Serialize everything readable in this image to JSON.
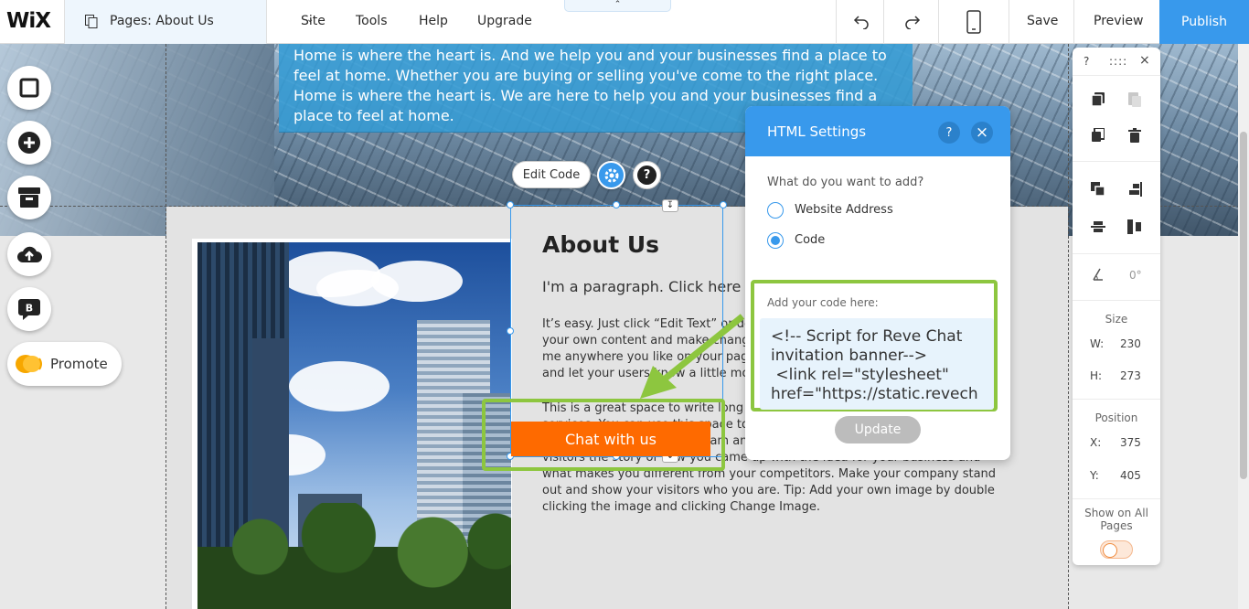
{
  "topbar": {
    "logo": "WiX",
    "pages_label": "Pages: About Us",
    "menu": [
      "Site",
      "Tools",
      "Help",
      "Upgrade"
    ],
    "handle_glyph": "⌃",
    "save": "Save",
    "preview": "Preview",
    "publish": "Publish"
  },
  "hero": {
    "text": "Home is where the heart is. And we help you and your businesses find a place to feel at home. Whether you are buying or selling you've come to the right place. Home is where the heart is. We  are here to help you and your businesses find a place to feel at home."
  },
  "toolbar_float": {
    "edit_code": "Edit Code",
    "help_glyph": "?"
  },
  "content": {
    "title": "About Us",
    "subtitle": "I'm a paragraph. Click here t",
    "p1": "It’s easy. Just click “Edit Text” or do your own content and make chang me anywhere you like on your pag and let your users know a little mo",
    "p2": "This is a great space to write long text about your company and your services. You can use this space to go into a little more detail about your company. Talk about your team and what services you provide. Tell your visitors the story of how you came up with the idea for your business and what makes you different from your competitors. Make your company stand out and show your visitors who you are. Tip: Add your own image by double clicking the image and clicking Change Image.",
    "chat_button": "Chat with us"
  },
  "left_rail": {
    "promote": "Promote",
    "blog_letter": "B"
  },
  "html_settings": {
    "title": "HTML Settings",
    "help": "?",
    "close": "×",
    "question": "What do you want to add?",
    "options": [
      "Website Address",
      "Code"
    ],
    "selected": "Code",
    "code_label": "Add your code here:",
    "code_value": "<!-- Script for Reve Chat\ninvitation banner-->\n <link rel=\"stylesheet\"\nhref=\"https://static.revech",
    "update": "Update"
  },
  "props_panel": {
    "help": "?",
    "close": "×",
    "rotation": "0°",
    "size_label": "Size",
    "w_label": "W:",
    "w_value": "230",
    "h_label": "H:",
    "h_value": "273",
    "position_label": "Position",
    "x_label": "X:",
    "x_value": "375",
    "y_label": "Y:",
    "y_value": "405",
    "show_all_pages": "Show on All Pages"
  },
  "colors": {
    "accent": "#3899ec",
    "chat_button": "#fe6a00",
    "highlight": "#8dc63f"
  }
}
